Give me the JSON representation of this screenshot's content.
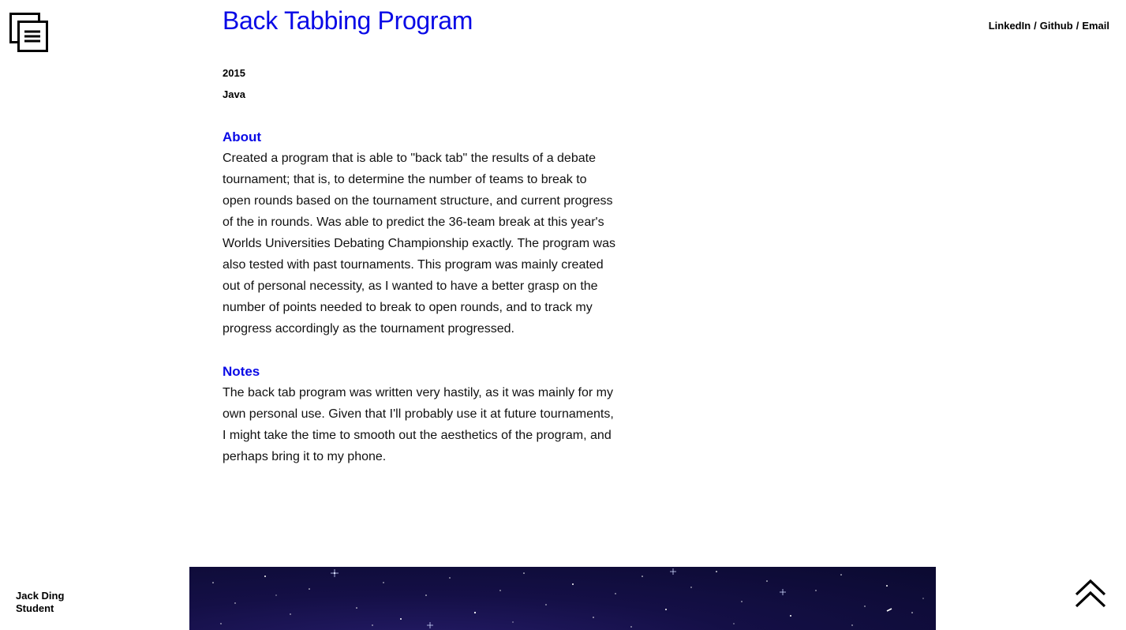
{
  "nav": {
    "menu_icon": "stacked-pages-menu-icon",
    "social_links": [
      "LinkedIn",
      "Github",
      "Email"
    ],
    "separator": "/"
  },
  "project": {
    "title": "Back Tabbing Program",
    "year": "2015",
    "language": "Java",
    "about_heading": "About",
    "about_text": "Created a program that is able to \"back tab\" the results of a debate tournament; that is, to determine the number of teams to break to open rounds based on the tournament structure, and current progress of the in rounds. Was able to predict the 36-team break at this year's Worlds Universities Debating Championship exactly. The program was also tested with past tournaments. This program was mainly created out of personal necessity, as I wanted to have a better grasp on the number of points needed to break to open rounds, and to track my progress accordingly as the tournament progressed.",
    "notes_heading": "Notes",
    "notes_text": "The back tab program was written very hastily, as it was mainly for my own personal use. Given that I'll probably use it at future tournaments, I might take the time to smooth out the aesthetics of the program, and perhaps bring it to my phone."
  },
  "footer": {
    "name": "Jack Ding",
    "role": "Student",
    "back_to_top_icon": "double-chevron-up-icon"
  },
  "colors": {
    "accent": "#0a0ae6",
    "banner_dark": "#0b0a30",
    "banner_mid": "#241b66"
  }
}
